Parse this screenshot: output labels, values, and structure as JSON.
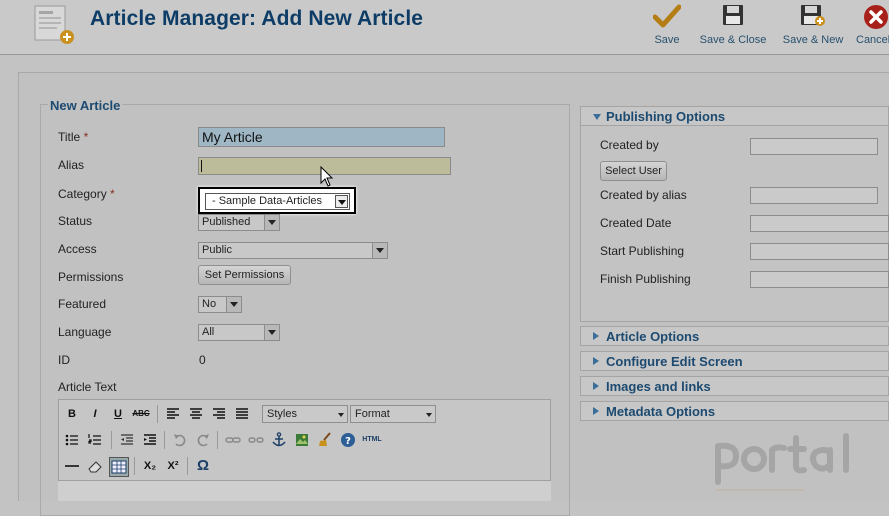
{
  "header": {
    "title": "Article Manager: Add New Article",
    "toolbar": [
      {
        "label": "Save",
        "icon": "checkmark-icon"
      },
      {
        "label": "Save & Close",
        "icon": "floppy-disk-icon"
      },
      {
        "label": "Save & New",
        "icon": "floppy-disk-new-icon"
      },
      {
        "label": "Cancel",
        "icon": "cancel-icon"
      }
    ]
  },
  "form": {
    "legend": "New Article",
    "title": {
      "label": "Title",
      "value": "My Article"
    },
    "alias": {
      "label": "Alias",
      "value": ""
    },
    "category": {
      "label": "Category",
      "value": "- Sample Data-Articles"
    },
    "status": {
      "label": "Status",
      "value": "Published"
    },
    "access": {
      "label": "Access",
      "value": "Public"
    },
    "permissions": {
      "label": "Permissions",
      "button": "Set Permissions"
    },
    "featured": {
      "label": "Featured",
      "value": "No"
    },
    "language": {
      "label": "Language",
      "value": "All"
    },
    "id": {
      "label": "ID",
      "value": "0"
    },
    "article_text": {
      "label": "Article Text"
    },
    "required_mark": "*"
  },
  "editor": {
    "styles": "Styles",
    "format": "Format",
    "tools_row1": [
      "B",
      "I",
      "U",
      "ABC"
    ],
    "html_label": "HTML",
    "subscript": "X₂",
    "superscript": "X²",
    "omega": "Ω"
  },
  "sidebar": {
    "publishing": {
      "title": "Publishing Options",
      "created_by": "Created by",
      "select_user": "Select User",
      "created_by_alias": "Created by alias",
      "created_date": "Created Date",
      "start_publishing": "Start Publishing",
      "finish_publishing": "Finish Publishing"
    },
    "sections": [
      "Article Options",
      "Configure Edit Screen",
      "Images and links",
      "Metadata Options"
    ]
  },
  "colors": {
    "accent": "#1c4a70",
    "title": "#0d3d66",
    "title_field": "#9fb6c4",
    "alias_field": "#bcbc9a"
  }
}
